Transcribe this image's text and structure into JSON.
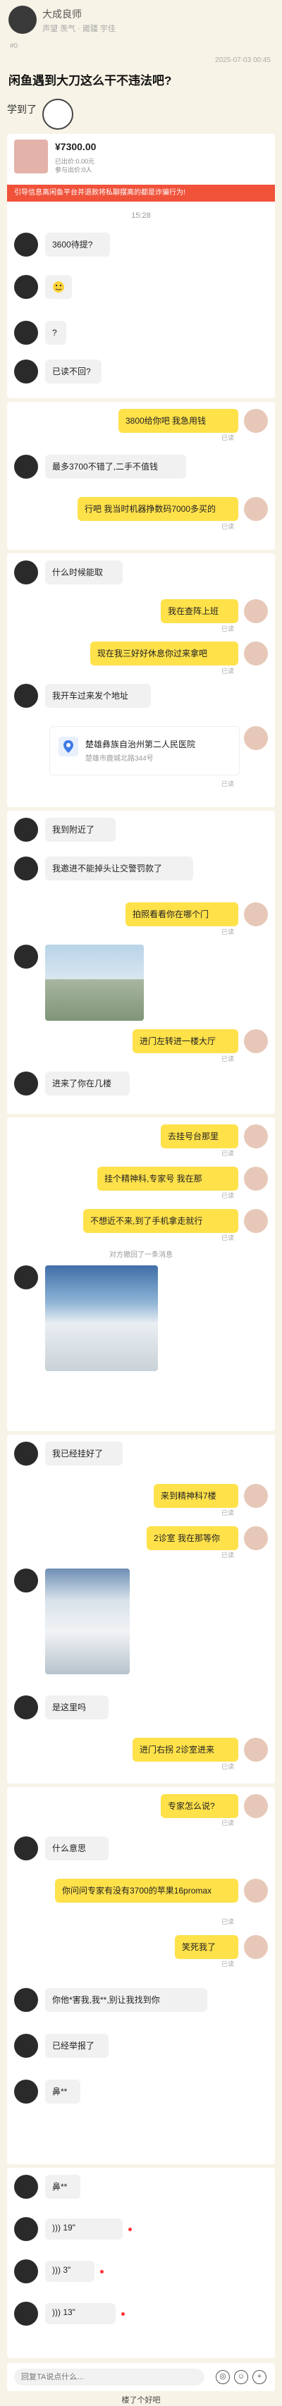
{
  "post": {
    "author": "大成良师",
    "author_meta": "声望 羡气 · 崴疆 宇佳",
    "num": "#0",
    "date": "2025-07-03 00:45",
    "title": "闲鱼遇到大刀这么干不违法吧?",
    "sticker_text": "学到了"
  },
  "item": {
    "price": "¥7300.00",
    "sub1": "已出价:0.00元",
    "sub2": "参与出价:0人",
    "warning": "引导信息离闲鱼平台并退款将私聊摆离的都是诈骗行为!"
  },
  "chat1": {
    "time": "15:28",
    "m1": "3600待提?",
    "m3": "?",
    "m4": "已读不回?"
  },
  "chat2": {
    "m1": "3800给你吧 我急用钱",
    "read1": "已读",
    "m2": "最多3700不错了,二手不值钱",
    "m3": "行吧 我当时机器挣数码7000多买的",
    "read3": "已读"
  },
  "chat3": {
    "m1": "什么时候能取",
    "m2": "我在查阵上班",
    "read2": "已读",
    "m3": "现在我三好好休息你过来拿吧",
    "read3": "已读",
    "m4": "我开车过来发个地址",
    "map_title": "楚雄彝族自治州第二人民医院",
    "map_sub": "楚雄市鹿城北路344号",
    "read4": "已读"
  },
  "chat4": {
    "m1": "我到附近了",
    "m2": "我邀进不能掉头让交警罚款了",
    "m3": "拍照看看你在哪个门",
    "read3": "已读",
    "m5": "进门左转进一楼大厅",
    "read5": "已读",
    "m6": "进来了你在几楼"
  },
  "chat5": {
    "m1": "去挂号台那里",
    "read1": "已读",
    "m2": "挂个精神科,专家号 我在那",
    "read2": "已读",
    "m3": "不想近不来,到了手机拿走就行",
    "read3": "已读",
    "notice": "对方撤回了一条消息"
  },
  "chat6": {
    "m1": "我已经挂好了",
    "m2": "来到精神科7楼",
    "read2": "已读",
    "m3": "2诊室 我在那等你",
    "read3": "已读",
    "m5": "是这里吗",
    "m6": "进门右拐 2诊室进来",
    "read6": "已读"
  },
  "chat7": {
    "m1": "专家怎么说?",
    "read1": "已读",
    "m2": "什么意思",
    "m3": "你问问专家有没有3700的苹果16promax",
    "read3": "已读",
    "m4": "笑死我了",
    "read4": "已读",
    "m5": "你他*害我,我**,别让我找到你",
    "m6": "已经举报了",
    "m7": "鼻**"
  },
  "chat8": {
    "m1": "鼻**",
    "v1": "19\"",
    "v2": "3\"",
    "v3": "13\""
  },
  "input": {
    "placeholder": "回复TA说点什么...",
    "bottom": "楼了个好吧"
  },
  "colors": {
    "accent_yellow": "#ffe14a",
    "warning_red": "#f0523a",
    "background": "#f7f3e6"
  }
}
